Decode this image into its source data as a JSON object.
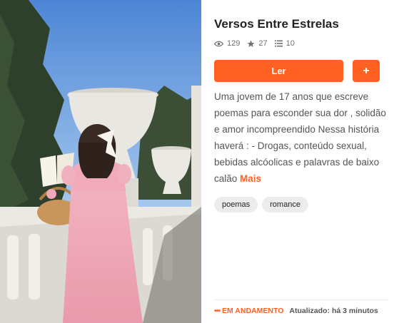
{
  "story": {
    "title": "Versos Entre Estrelas",
    "stats": {
      "reads": "129",
      "votes": "27",
      "parts": "10"
    },
    "read_button_label": "Ler",
    "add_button_label": "+",
    "description": "Uma jovem de 17 anos que escreve poemas para esconder sua dor , solidão e amor incompreendido Nessa história haverá : - Drogas, conteúdo sexual, bebidas alcóolicas e palavras de baixo calão",
    "more_label": "Mais",
    "tags": [
      "poemas",
      "romance"
    ],
    "status_dots": "•••",
    "status": "EM ANDAMENTO",
    "updated_label": "Atualizado:",
    "updated_time": "há 3 minutos"
  },
  "colors": {
    "accent": "#ff6122",
    "tag_bg": "#ececec",
    "text_muted": "#555555"
  },
  "icons": {
    "reads": "eye-icon",
    "votes": "star-icon",
    "parts": "list-icon"
  }
}
